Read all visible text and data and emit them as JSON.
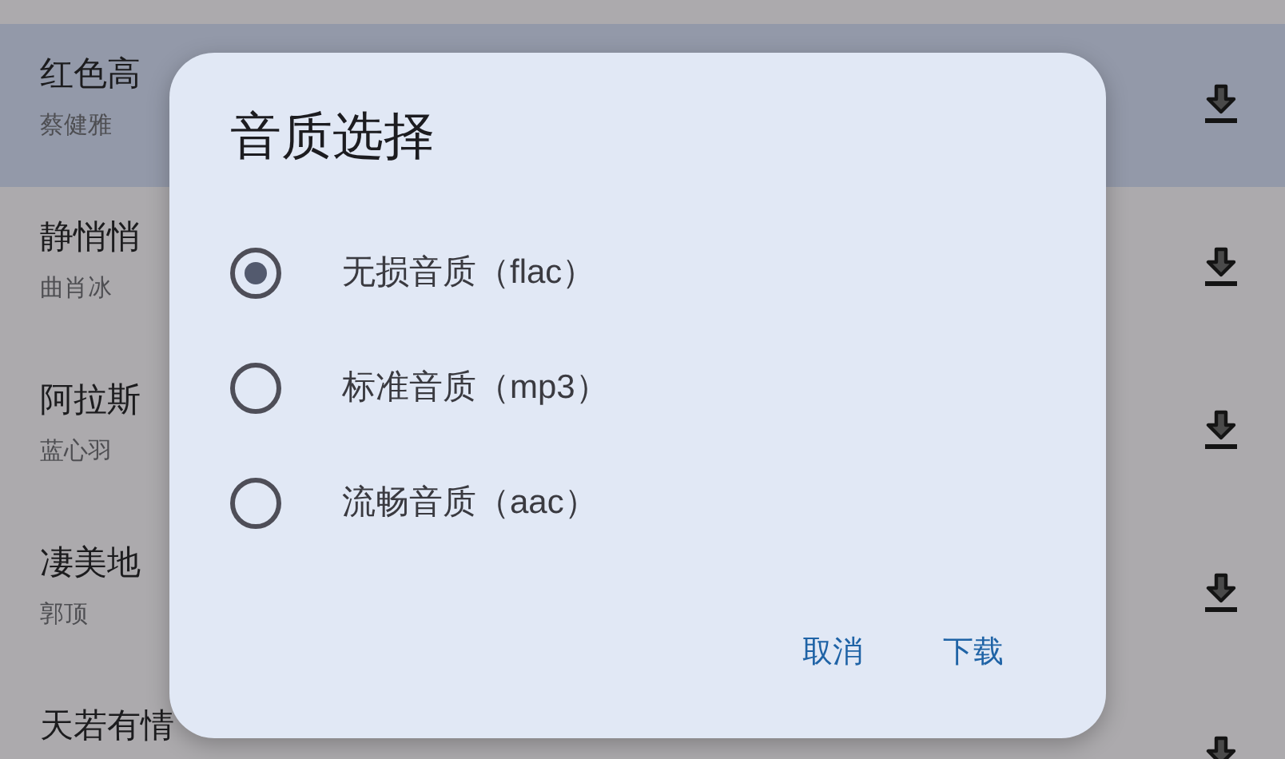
{
  "songs": [
    {
      "title": "红色高",
      "artist": "蔡健雅",
      "selected": true
    },
    {
      "title": "静悄悄",
      "artist": "曲肖冰",
      "selected": false
    },
    {
      "title": "阿拉斯",
      "artist": "蓝心羽",
      "selected": false
    },
    {
      "title": "凄美地",
      "artist": "郭顶",
      "selected": false
    },
    {
      "title": "天若有情",
      "selected": false
    }
  ],
  "dialog": {
    "title": "音质选择",
    "options": [
      {
        "label": "无损音质（flac）",
        "selected": true
      },
      {
        "label": "标准音质（mp3）",
        "selected": false
      },
      {
        "label": "流畅音质（aac）",
        "selected": false
      }
    ],
    "buttons": [
      "取消",
      "下载"
    ]
  }
}
